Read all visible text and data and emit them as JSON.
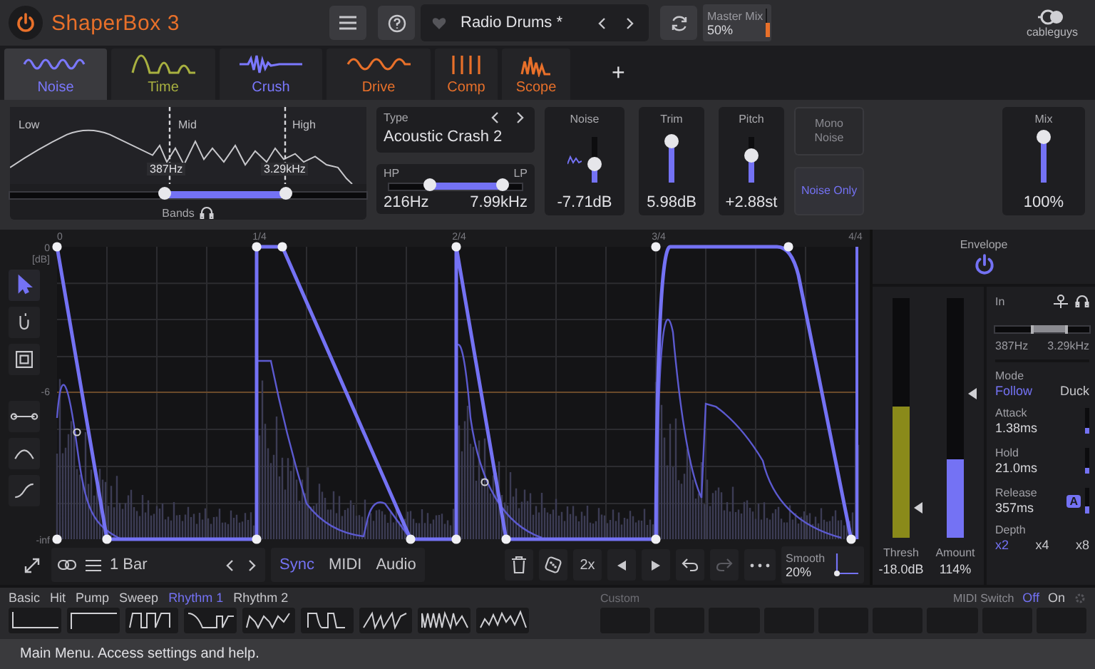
{
  "header": {
    "logo": "ShaperBox 3",
    "preset": "Radio Drums *",
    "master_mix": {
      "label": "Master Mix",
      "value": "50%",
      "level": 0.5
    },
    "brand": "cableguys"
  },
  "tabs": [
    {
      "label": "Noise",
      "kind": "noise",
      "color": "#7b78ff",
      "selected": true
    },
    {
      "label": "Time",
      "kind": "time",
      "color": "#a8b040",
      "selected": false
    },
    {
      "label": "Crush",
      "kind": "crush",
      "color": "#7b78ff",
      "selected": false
    },
    {
      "label": "Drive",
      "kind": "drive",
      "color": "#e8702a",
      "selected": false
    },
    {
      "label": "Comp",
      "kind": "comp",
      "color": "#e8702a",
      "selected": false
    },
    {
      "label": "Scope",
      "kind": "scope",
      "color": "#e8702a",
      "selected": false
    }
  ],
  "add_tab": "+",
  "bands": {
    "labels": [
      "Low",
      "Mid",
      "High"
    ],
    "low_freq": "387Hz",
    "high_freq": "3.29kHz",
    "caption": "Bands",
    "range": [
      {
        "level": 0.43
      },
      {
        "level": 0.77
      }
    ]
  },
  "type": {
    "label": "Type",
    "value": "Acoustic Crash 2"
  },
  "filter": {
    "hp_label": "HP",
    "lp_label": "LP",
    "hp_value": "216Hz",
    "lp_value": "7.99kHz",
    "range": [
      {
        "level": 0.3
      },
      {
        "level": 0.85
      }
    ]
  },
  "sliders": [
    {
      "label": "Noise",
      "value": "-7.71dB",
      "level": 0.4
    },
    {
      "label": "Trim",
      "value": "5.98dB",
      "level": 0.92
    },
    {
      "label": "Pitch",
      "value": "+2.88st",
      "level": 0.6
    }
  ],
  "toggles": [
    {
      "label": "Mono Noise",
      "on": false
    },
    {
      "label": "Noise Only",
      "on": true
    }
  ],
  "mix": {
    "label": "Mix",
    "value": "100%",
    "level": 1
  },
  "editor": {
    "y_labels": [
      "0",
      "[dB]",
      "-6",
      "-inf"
    ],
    "x_labels": [
      "0",
      "1/4",
      "2/4",
      "3/4",
      "4/4"
    ],
    "tools": [
      {
        "kind": "pointer",
        "selected": true
      },
      {
        "kind": "magnet",
        "selected": false
      },
      {
        "kind": "select",
        "selected": false
      },
      {
        "kind": "line",
        "selected": false
      },
      {
        "kind": "curve",
        "selected": false
      },
      {
        "kind": "scurve",
        "selected": false
      }
    ],
    "length": "1 Bar",
    "modes": [
      {
        "label": "Sync",
        "selected": true
      },
      {
        "label": "MIDI",
        "selected": false
      },
      {
        "label": "Audio",
        "selected": false
      }
    ],
    "grid": "2x",
    "smooth": {
      "label": "Smooth",
      "value": "20%"
    }
  },
  "envelope": {
    "title": "Envelope",
    "on": true,
    "in_label": "In",
    "freq_low": "387Hz",
    "freq_high": "3.29kHz",
    "range": [
      {
        "level": 0.4
      },
      {
        "level": 0.75
      }
    ],
    "meters": [
      {
        "label": "Thresh",
        "value": "-18.0dB",
        "kind": "signal",
        "level": 0.55
      },
      {
        "label": "Amount",
        "value": "114%",
        "kind": "amount",
        "level": 0.33
      }
    ],
    "mode_label": "Mode",
    "modes": [
      {
        "label": "Follow",
        "selected": true
      },
      {
        "label": "Duck",
        "selected": false
      }
    ],
    "params": [
      {
        "label": "Attack",
        "value": "1.38ms",
        "level": 0.2
      },
      {
        "label": "Hold",
        "value": "21.0ms",
        "level": 0.2
      },
      {
        "label": "Release",
        "value": "357ms",
        "badge": "A",
        "level": 0.3
      }
    ],
    "depth_label": "Depth",
    "depths": [
      {
        "label": "x2",
        "selected": true
      },
      {
        "label": "x4",
        "selected": false
      },
      {
        "label": "x8",
        "selected": false
      }
    ]
  },
  "presets": {
    "categories": [
      {
        "label": "Basic",
        "selected": false
      },
      {
        "label": "Hit",
        "selected": false
      },
      {
        "label": "Pump",
        "selected": false
      },
      {
        "label": "Sweep",
        "selected": false
      },
      {
        "label": "Rhythm 1",
        "selected": true
      },
      {
        "label": "Rhythm 2",
        "selected": false
      }
    ],
    "custom_label": "Custom",
    "midi_label": "MIDI Switch",
    "midi_options": [
      {
        "label": "Off",
        "selected": true
      },
      {
        "label": "On",
        "selected": false
      }
    ]
  },
  "status": "Main Menu. Access settings and help."
}
